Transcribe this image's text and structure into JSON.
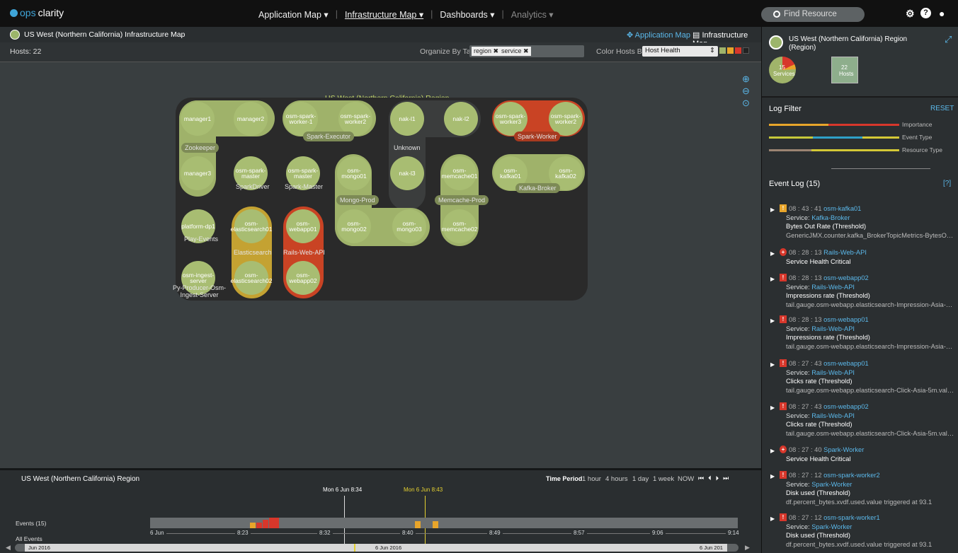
{
  "app": {
    "logo_prefix": "ops",
    "logo_suffix": "clarity"
  },
  "nav": [
    {
      "label": "Application Map ▾"
    },
    {
      "label": "Infrastructure Map ▾"
    },
    {
      "label": "Dashboards ▾"
    },
    {
      "label": "Analytics ▾"
    }
  ],
  "find": {
    "placeholder": "Find Resource"
  },
  "icons": {
    "settings": "gear-icon",
    "help": "help-icon",
    "user": "user-icon"
  },
  "map": {
    "title": "US West (Northern California) Infrastructure Map",
    "app_map_link": "Application Map",
    "infra_map_link": "Infrastructure Map",
    "hosts": "Hosts: 22",
    "organize_label": "Organize By Tag:",
    "tags": [
      "region",
      "service"
    ],
    "color_label": "Color Hosts By:",
    "color_value": "Host Health",
    "swatches": [
      "#a0b46a",
      "#e8a52a",
      "#d7372b",
      "#222"
    ],
    "region_title": "US West (Northern California) Region",
    "groups": {
      "zookeeper": "Zookeeper",
      "spark_executor": "Spark-Executor",
      "unknown": "Unknown",
      "spark_worker": "Spark-Worker",
      "spark_driver": "SparkDriver",
      "spark_master": "Spark-Master",
      "mongo": "Mongo-Prod",
      "memcache": "Memcache-Prod",
      "kafka": "Kafka-Broker",
      "play": "Play-Events",
      "elastic": "Elasticsearch",
      "rails": "Rails-Web-API",
      "py": "Py-Producer-Osm-\nIngest-Server"
    },
    "nodes": {
      "manager1": "manager1",
      "manager2": "manager2",
      "manager3": "manager3",
      "sw1": "osm-spark-\nworker-1",
      "sw2": "osm-spark-\nworker2",
      "nak1": "nak-l1",
      "nak2": "nak-l2",
      "nak3": "nak-l3",
      "sw3": "osm-spark-\nworker3",
      "sw4": "osm-spark-\nworker2",
      "sm1": "osm-spark-master",
      "sm2": "osm-spark-master",
      "mongo1": "osm-mongo01",
      "mongo2": "osm-mongo02",
      "mongo3": "osm-mongo03",
      "mc1": "osm-\nmemcache01",
      "mc2": "osm-\nmemcache02",
      "kafka1": "osm-kafka01",
      "kafka2": "osm-kafka02",
      "dp1": "platform-dp1",
      "es1": "osm-\nelasticsearch01",
      "es2": "osm-\nelasticsearch02",
      "wa1": "osm-webapp01",
      "wa2": "osm-webapp02",
      "ingest": "osm-ingest-server"
    }
  },
  "timeline": {
    "region": "US West (Northern California) Region",
    "time_period_label": "Time Period",
    "periods": [
      "1 hour",
      "4 hours",
      "1 day",
      "1 week",
      "NOW"
    ],
    "marker1": "Mon 6 Jun 8:34",
    "marker2": "Mon 6 Jun 8:43",
    "events_label": "Events (15)",
    "all_events_label": "All Events",
    "ticks": [
      "6 Jun",
      "8:23",
      "8:32",
      "8:40",
      "8:49",
      "8:57",
      "9:06",
      "9:14"
    ],
    "scroll_start": "Jun 2016",
    "scroll_mid": "6 Jun 2016",
    "scroll_end": "6 Jun 201"
  },
  "side": {
    "region_title": "US West (Northern California) Region",
    "region_sub": "(Region)",
    "services_count": "15",
    "services_label": "Services",
    "hosts_count": "22",
    "hosts_label": "Hosts",
    "log_filter": "Log Filter",
    "reset": "RESET",
    "filters": [
      "Importance",
      "Event Type",
      "Resource Type"
    ],
    "event_log": "Event Log (15)",
    "help": "[?]",
    "events": [
      {
        "time": "08 : 43 : 41",
        "res": "osm-kafka01",
        "svc_label": "Service:",
        "svc": "Kafka-Broker",
        "title": "Bytes Out Rate (Threshold)",
        "detail": "GenericJMX.counter.kafka_BrokerTopicMetrics-BytesOutP..."
      },
      {
        "time": "08 : 28 : 13",
        "res": "Rails-Web-API",
        "title": "Service Health Critical"
      },
      {
        "time": "08 : 28 : 13",
        "res": "osm-webapp02",
        "svc_label": "Service:",
        "svc": "Rails-Web-API",
        "title": "Impressions rate (Threshold)",
        "detail": "tail.gauge.osm-webapp.elasticsearch-Impression-Asia-5m...."
      },
      {
        "time": "08 : 28 : 13",
        "res": "osm-webapp01",
        "svc_label": "Service:",
        "svc": "Rails-Web-API",
        "title": "Impressions rate (Threshold)",
        "detail": "tail.gauge.osm-webapp.elasticsearch-Impression-Asia-5m...."
      },
      {
        "time": "08 : 27 : 43",
        "res": "osm-webapp01",
        "svc_label": "Service:",
        "svc": "Rails-Web-API",
        "title": "Clicks rate (Threshold)",
        "detail": "tail.gauge.osm-webapp.elasticsearch-Click-Asia-5m.value t..."
      },
      {
        "time": "08 : 27 : 43",
        "res": "osm-webapp02",
        "svc_label": "Service:",
        "svc": "Rails-Web-API",
        "title": "Clicks rate (Threshold)",
        "detail": "tail.gauge.osm-webapp.elasticsearch-Click-Asia-5m.value t..."
      },
      {
        "time": "08 : 27 : 40",
        "res": "Spark-Worker",
        "title": "Service Health Critical"
      },
      {
        "time": "08 : 27 : 12",
        "res": "osm-spark-worker2",
        "svc_label": "Service:",
        "svc": "Spark-Worker",
        "title": "Disk used (Threshold)",
        "detail": "df.percent_bytes.xvdf.used.value triggered at 93.1"
      },
      {
        "time": "08 : 27 : 12",
        "res": "osm-spark-worker1",
        "svc_label": "Service:",
        "svc": "Spark-Worker",
        "title": "Disk used (Threshold)",
        "detail": "df.percent_bytes.xvdf.used.value triggered at 93.1"
      }
    ]
  }
}
